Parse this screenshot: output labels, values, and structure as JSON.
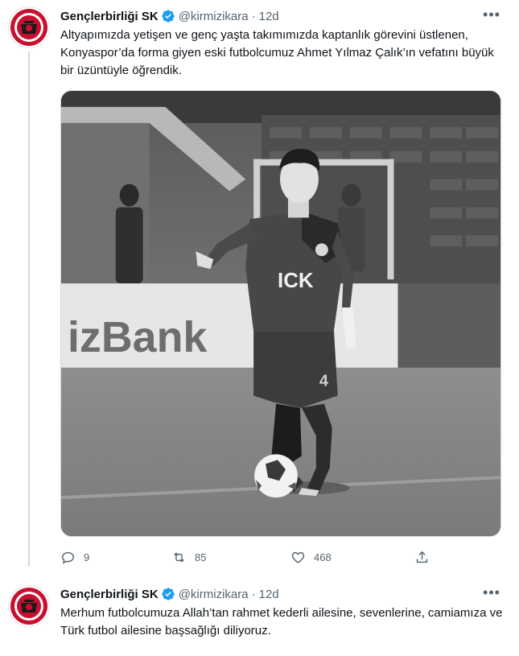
{
  "tweets": [
    {
      "author": {
        "name": "Gençlerbirliği SK",
        "handle": "@kirmizikara",
        "avatar_icon": "club-crest-icon",
        "verified_icon": "verified-badge-icon"
      },
      "time": "12d",
      "separator": "·",
      "more_icon": "more-options-icon",
      "text": "Altyapımızda yetişen ve genç yaşta takımımızda kaptanlık görevini üstlenen, Konyaspor’da forma giyen eski futbolcumuz Ahmet Yılmaz Çalık’ın vefatını büyük bir üzüntüyle öğrendik.",
      "media": {
        "alt": "Black and white photo of a footballer dribbling a ball on a pitch",
        "billboard_text": "izBank",
        "shirt_text": "ICK",
        "shirt_number": "4"
      },
      "actions": {
        "reply": {
          "icon": "reply-icon",
          "count": "9"
        },
        "retweet": {
          "icon": "retweet-icon",
          "count": "85"
        },
        "like": {
          "icon": "like-icon",
          "count": "468"
        },
        "share": {
          "icon": "share-icon"
        }
      }
    },
    {
      "author": {
        "name": "Gençlerbirliği SK",
        "handle": "@kirmizikara",
        "avatar_icon": "club-crest-icon",
        "verified_icon": "verified-badge-icon"
      },
      "time": "12d",
      "separator": "·",
      "more_icon": "more-options-icon",
      "text": "Merhum futbolcumuza Allah’tan rahmet kederli ailesine, sevenlerine, camiamıza ve Türk futbol ailesine başsağlığı diliyoruz."
    }
  ],
  "colors": {
    "text_primary": "#0f1419",
    "text_secondary": "#536471",
    "verified_blue": "#1d9bf0",
    "crest_red": "#c8102e",
    "thread_line": "#cfd9de"
  }
}
